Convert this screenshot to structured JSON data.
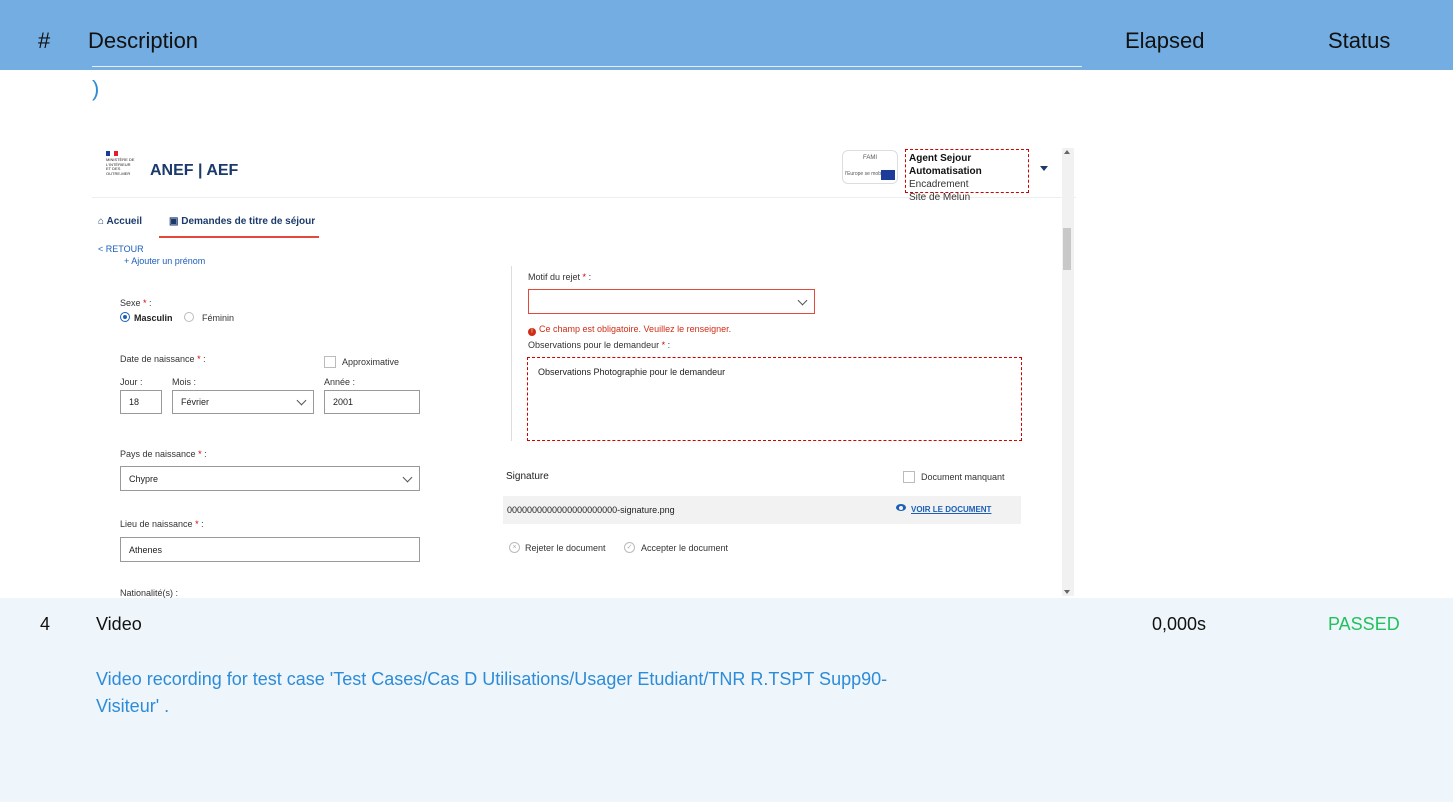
{
  "report_header": {
    "col_num": "#",
    "col_description": "Description",
    "col_elapsed": "Elapsed",
    "col_status": "Status"
  },
  "prev_row": {
    "closing_paren": ")"
  },
  "screenshot": {
    "ministry_text": "MINISTÈRE DE L'INTÉRIEUR ET DES OUTRE-MER",
    "app_title": "ANEF | AEF",
    "fami_text": "FAMI",
    "fami_subtitle": "l'Europe se mobilise",
    "user": {
      "name": "Agent Sejour Automatisation",
      "role": "Encadrement",
      "site": "Site de Melun"
    },
    "nav": {
      "home": "Accueil",
      "demandes": "Demandes de titre de séjour"
    },
    "retour": "< RETOUR",
    "add_prenom": "+ Ajouter un prénom",
    "sexe": {
      "label": "Sexe",
      "required": "*",
      "options": [
        "Masculin",
        "Féminin"
      ],
      "selected": "Masculin"
    },
    "date_naissance": {
      "label": "Date de naissance",
      "required": "*",
      "approx_label": "Approximative",
      "jour_label": "Jour :",
      "mois_label": "Mois :",
      "annee_label": "Année :",
      "jour": "18",
      "mois": "Février",
      "annee": "2001"
    },
    "pays_naissance": {
      "label": "Pays de naissance",
      "required": "*",
      "value": "Chypre"
    },
    "lieu_naissance": {
      "label": "Lieu de naissance",
      "required": "*",
      "value": "Athenes"
    },
    "nationalite_label": "Nationalité(s) :",
    "motif_rejet": {
      "label": "Motif du rejet",
      "required": "*",
      "value": "",
      "error": "Ce champ est obligatoire. Veuillez le renseigner."
    },
    "observations": {
      "label": "Observations pour le demandeur",
      "required": "*",
      "value": "Observations Photographie pour le demandeur"
    },
    "signature": {
      "title": "Signature",
      "missing_label": "Document manquant",
      "filename": "0000000000000000000000-signature.png",
      "view_link": "VOIR LE DOCUMENT",
      "reject_label": "Rejeter le document",
      "accept_label": "Accepter le document"
    }
  },
  "row4": {
    "num": "4",
    "description": "Video",
    "elapsed": "0,000s",
    "status": "PASSED",
    "video_text": "Video recording for test case 'Test Cases/Cas D Utilisations/Usager Etudiant/TNR R.TSPT Supp90-Visiteur' ."
  },
  "colors": {
    "header_bg": "#73ade1",
    "row_bg": "#eef6fc",
    "link_blue": "#2d8bd8",
    "passed_green": "#23c15d",
    "error_red": "#d02d16"
  }
}
